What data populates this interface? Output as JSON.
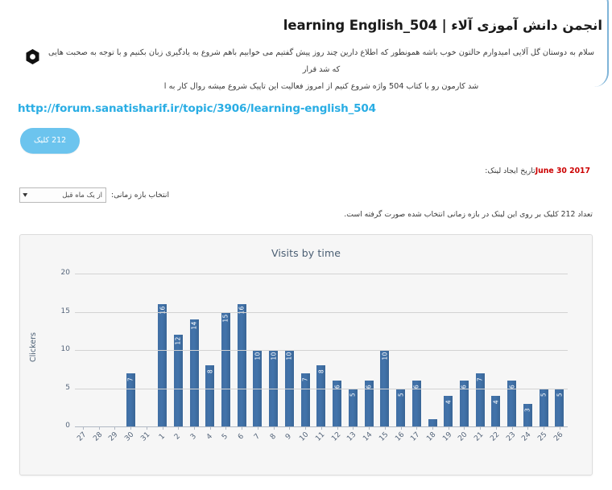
{
  "post": {
    "title": "learning English_504 | انجمن دانش آموزی آلاء",
    "icon": "hexagon-icon",
    "text_line1": "سلام به دوستان گل آلایی امیدوارم حالتون خوب باشه همونطور که اطلاع دارین چند روز پیش گفتیم می خوابیم باهم شروع به یادگیری زبان بکنیم و با توجه به صحبت هایی که شد قرار",
    "text_line2": "شد کارمون رو با کتاب 504 واژه شروع کنیم از امروز فعالیت این تاپیک شروع میشه روال کار به ا",
    "link": "http://forum.sanatisharif.ir/topic/3906/learning-english_504",
    "click_badge": "212 کلیک"
  },
  "meta": {
    "created_label": "تاریخ ایجاد لینک:",
    "created_date": "June 30 2017",
    "range_label": "انتخاب بازه زمانی:",
    "range_value": "از یک ماه قبل",
    "range_caret": "▼",
    "note": "تعداد 212 کلیک بر روی این لینک در بازه زمانی انتخاب شده صورت گرفته است."
  },
  "colors": {
    "link": "#29ade4",
    "badge": "#6cc4ee",
    "date": "#cc0000",
    "bar": "#3d6fa5",
    "panel_bg": "#f6f6f6",
    "frame": "#7fb4d8"
  },
  "chart_data": {
    "type": "bar",
    "title": "Visits by time",
    "xlabel": "",
    "ylabel": "Clickers",
    "ylim": [
      0,
      20
    ],
    "yticks": [
      0,
      5,
      10,
      15,
      20
    ],
    "grid": true,
    "legend": "none",
    "categories": [
      "27",
      "28",
      "29",
      "30",
      "31",
      "1",
      "2",
      "3",
      "4",
      "5",
      "6",
      "7",
      "8",
      "9",
      "10",
      "11",
      "12",
      "13",
      "14",
      "15",
      "16",
      "17",
      "18",
      "19",
      "20",
      "21",
      "22",
      "23",
      "24",
      "25",
      "26"
    ],
    "values": [
      0,
      0,
      0,
      7,
      0,
      16,
      12,
      14,
      8,
      15,
      16,
      10,
      10,
      10,
      7,
      8,
      6,
      5,
      6,
      10,
      5,
      6,
      1,
      4,
      6,
      7,
      4,
      6,
      3,
      5,
      5
    ]
  }
}
